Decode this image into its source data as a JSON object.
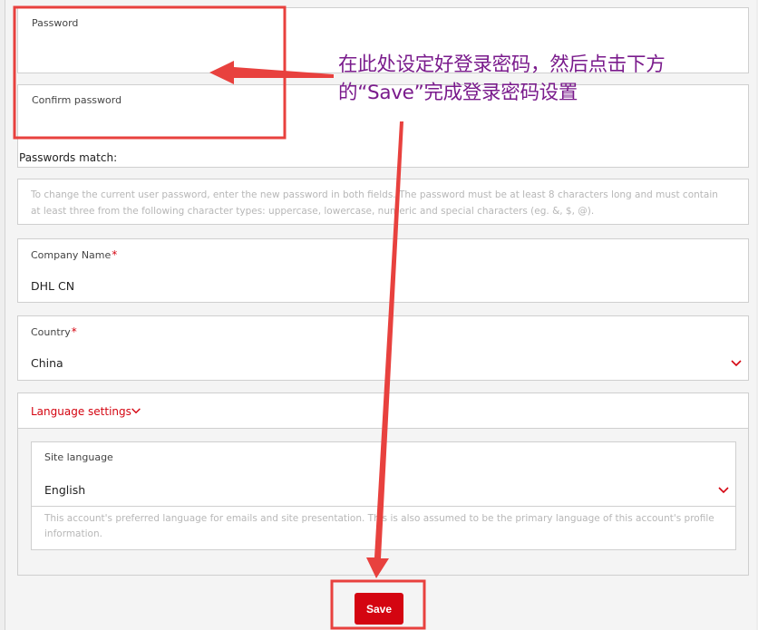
{
  "form": {
    "password": {
      "label": "Password",
      "value": ""
    },
    "confirm_password": {
      "label": "Confirm password",
      "value": ""
    },
    "passwords_match_label": "Passwords match:",
    "password_help": "To change the current user password, enter the new password in both fields. The password must be at least 8 characters long and must contain at least three from the following character types: uppercase, lowercase, numeric and special characters (eg. &, $, @).",
    "company_name": {
      "label": "Company Name",
      "required_mark": "*",
      "value": "DHL CN"
    },
    "country": {
      "label": "Country",
      "required_mark": "*",
      "value": "China"
    },
    "language_settings": {
      "label": "Language settings",
      "site_language": {
        "label": "Site language",
        "value": "English",
        "help": "This account's preferred language for emails and site presentation. This is also assumed to be the primary language of this account's profile information."
      }
    },
    "save_label": "Save"
  },
  "annotation": {
    "text": "在此处设定好登录密码，然后点击下方的“Save”完成登录密码设置",
    "color": "#7a1b8c",
    "arrow_color": "#e8413e"
  },
  "colors": {
    "brand_red": "#d40511"
  }
}
